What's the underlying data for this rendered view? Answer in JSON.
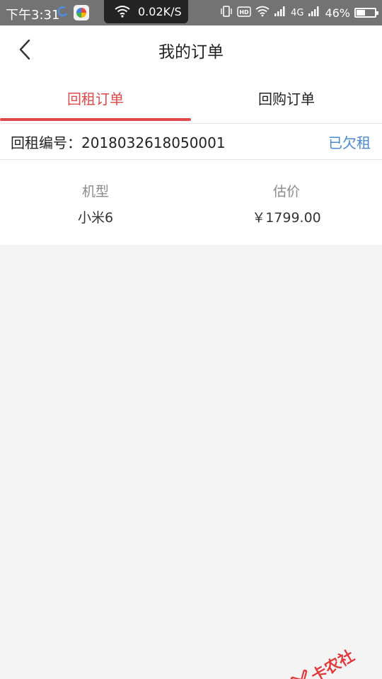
{
  "status_bar": {
    "time": "下午3:31",
    "net_speed": "0.02K/S",
    "network_type": "4G",
    "battery_percent": "46%",
    "battery_level": 0.46
  },
  "header": {
    "title": "我的订单"
  },
  "tabs": [
    {
      "label": "回租订单",
      "active": true
    },
    {
      "label": "回购订单",
      "active": false
    }
  ],
  "order": {
    "number_label": "回租编号：2018032618050001",
    "status": "已欠租"
  },
  "details": {
    "model_label": "机型",
    "model_value": "小米6",
    "price_label": "估价",
    "price_value": "￥1799.00"
  },
  "watermark": {
    "text": "卡农社区"
  },
  "colors": {
    "accent": "#e0494a",
    "link": "#4a8ad4",
    "background": "#f4f4f4"
  }
}
